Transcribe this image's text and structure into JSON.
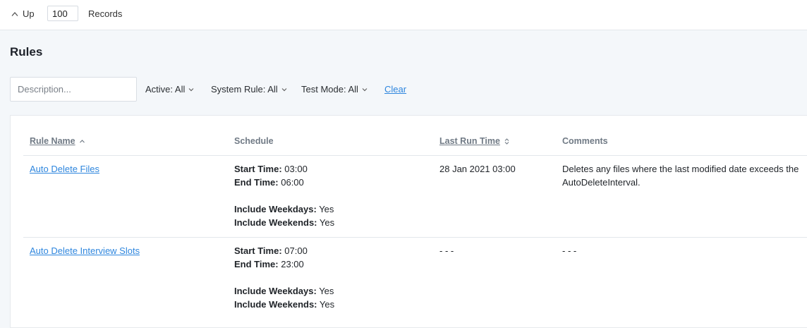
{
  "toolbar": {
    "up_label": "Up",
    "records_value": "100",
    "records_label": "Records"
  },
  "page": {
    "title": "Rules"
  },
  "filters": {
    "description_placeholder": "Description...",
    "active": "Active: All",
    "system_rule": "System Rule: All",
    "test_mode": "Test Mode: All",
    "clear": "Clear"
  },
  "table": {
    "columns": {
      "rule_name": "Rule Name",
      "schedule": "Schedule",
      "last_run_time": "Last Run Time",
      "comments": "Comments"
    },
    "schedule_labels": {
      "start": "Start Time:",
      "end": "End Time:",
      "weekdays": "Include Weekdays:",
      "weekends": "Include Weekends:"
    },
    "rows": [
      {
        "name": "Auto Delete Files",
        "start_time": "03:00",
        "end_time": "06:00",
        "weekdays": "Yes",
        "weekends": "Yes",
        "last_run": "28 Jan 2021 03:00",
        "comment": "Deletes any files where the last modified date exceeds the AutoDeleteInterval."
      },
      {
        "name": "Auto Delete Interview Slots",
        "start_time": "07:00",
        "end_time": "23:00",
        "weekdays": "Yes",
        "weekends": "Yes",
        "last_run": "- - -",
        "comment": "- - -"
      }
    ]
  },
  "colors": {
    "accent": "#2e86de",
    "background": "#f4f7fa",
    "header_text": "#707a85"
  },
  "icons": {
    "up": "chevron-up-icon",
    "dropdown": "chevron-down-icon",
    "sort_asc": "sort-ascending-icon",
    "sort": "sort-both-icon"
  }
}
